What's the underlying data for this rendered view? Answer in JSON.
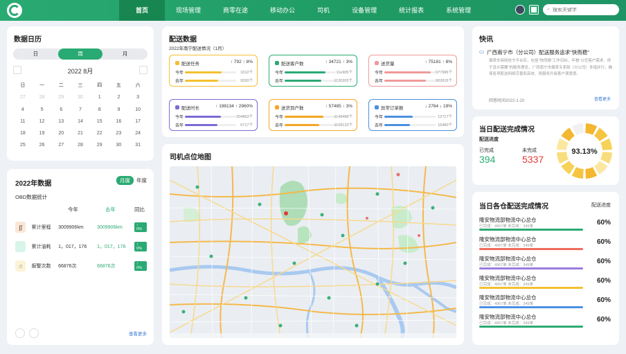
{
  "nav": {
    "items": [
      "首页",
      "现场管理",
      "商零在途",
      "移动办公",
      "司机",
      "设备管理",
      "统计报表",
      "系统管理"
    ],
    "search_placeholder": "搜索关键字"
  },
  "calendar": {
    "title": "数据日历",
    "tabs": [
      "日",
      "周",
      "月"
    ],
    "month": "2022 8月",
    "weekdays": [
      "日",
      "一",
      "二",
      "三",
      "四",
      "五",
      "六"
    ],
    "days": [
      {
        "d": "27",
        "dim": true
      },
      {
        "d": "28",
        "dim": true
      },
      {
        "d": "29",
        "dim": true
      },
      {
        "d": "30",
        "dim": true
      },
      {
        "d": "1",
        "dim": false
      },
      {
        "d": "2",
        "dim": false
      },
      {
        "d": "3",
        "dim": false
      },
      {
        "d": "4",
        "dim": false
      },
      {
        "d": "5",
        "dim": false
      },
      {
        "d": "6",
        "dim": false
      },
      {
        "d": "7",
        "dim": false
      },
      {
        "d": "8",
        "dim": false
      },
      {
        "d": "9",
        "dim": false
      },
      {
        "d": "10",
        "dim": false
      },
      {
        "d": "11",
        "dim": false
      },
      {
        "d": "12",
        "dim": false
      },
      {
        "d": "13",
        "dim": false
      },
      {
        "d": "14",
        "dim": false
      },
      {
        "d": "15",
        "dim": false
      },
      {
        "d": "16",
        "dim": false
      },
      {
        "d": "17",
        "dim": false
      },
      {
        "d": "18",
        "dim": false
      },
      {
        "d": "19",
        "dim": false
      },
      {
        "d": "20",
        "dim": false
      },
      {
        "d": "21",
        "dim": false
      },
      {
        "d": "22",
        "dim": false
      },
      {
        "d": "23",
        "dim": false
      },
      {
        "d": "24",
        "dim": false
      },
      {
        "d": "25",
        "dim": false
      },
      {
        "d": "26",
        "dim": false
      },
      {
        "d": "27",
        "dim": false
      },
      {
        "d": "28",
        "dim": false
      },
      {
        "d": "29",
        "dim": false
      },
      {
        "d": "30",
        "dim": false
      },
      {
        "d": "31",
        "dim": false
      }
    ]
  },
  "year_data": {
    "title": "2022年数据",
    "toggle": [
      "月度",
      "年度"
    ],
    "subtitle": "OBD数据统计",
    "cols": [
      "今年",
      "去年",
      "同比"
    ],
    "rows": [
      {
        "label": "累计里程",
        "this": "3009906km",
        "last": "3009906km",
        "badge": "↑ 0%",
        "icon": "road-icon",
        "color": "#fbe6d6",
        "glyph": "∫∫"
      },
      {
        "label": "累计油耗",
        "this": "1，017，176",
        "last": "1，017，176",
        "badge": "↑ 0%",
        "icon": "fuel-icon",
        "color": "#d8f5ea",
        "glyph": ""
      },
      {
        "label": "报警次数",
        "this": "66876次",
        "last": "66876次",
        "badge": "↑ 0%",
        "icon": "alarm-icon",
        "color": "#fdf3d6",
        "glyph": "☝"
      }
    ],
    "more": "查看更多"
  },
  "delivery": {
    "title": "配送数据",
    "subtitle": "2022年南宁配送情况（1月）",
    "cards": [
      {
        "name": "配送任务",
        "value": "↑ 792 ↑ 8%",
        "this_label": "今年",
        "last_label": "去年",
        "this_num": "1012个",
        "last_num": "9320个",
        "color": "#f3c02f",
        "fill": 0.72
      },
      {
        "name": "配送客户数",
        "value": "↑ 34721 ↑ 3%",
        "this_label": "今年",
        "last_label": "去年",
        "this_num": "11e905个",
        "last_num": "1126303个",
        "color": "#2aaa73",
        "fill": 0.8
      },
      {
        "name": "送货量",
        "value": "↑ 75181 ↑ 8%",
        "this_label": "今年",
        "last_label": "去年",
        "this_num": "977995个",
        "last_num": "902615个",
        "color": "#ef9a9a",
        "fill": 0.9
      },
      {
        "name": "配送时长",
        "value": "↑ 198134 ↑ 2960%",
        "this_label": "今年",
        "last_label": "去年",
        "this_num": "204863个",
        "last_num": "6717个",
        "color": "#7b6bd6",
        "fill": 0.7
      },
      {
        "name": "送货到户数",
        "value": "↑ 57485 ↑ 3%",
        "this_label": "今年",
        "last_label": "去年",
        "this_num": "1149488个",
        "last_num": "1109123个",
        "color": "#f5a623",
        "fill": 0.75
      },
      {
        "name": "异常订单数",
        "value": "↓ 2764 ↓ 19%",
        "this_label": "今年",
        "last_label": "去年",
        "this_num": "12717个",
        "last_num": "15480个",
        "color": "#4a90e2",
        "fill": 0.55
      }
    ]
  },
  "map": {
    "title": "司机点位地图"
  },
  "news": {
    "title": "快讯",
    "headline": "广西南宁市（分公司）配送服务追求\"快而稳\"",
    "body": "烟草市商网信令平台实，包括\"快而稳\"工作目标，牢看\"以任客户需求、终于设计需要\"的服务理念，广西南宁市烟草专卖局（分公司）多措并行，确保各项配送网络完善和高效、扬服务升级客户满意度。",
    "time": "回答时间2022-1-20",
    "more": "查看更多"
  },
  "today": {
    "title": "当日配送完成情况",
    "sub": "配送进度",
    "done_label": "已完成",
    "todo_label": "未完成",
    "done": "394",
    "todo": "5337",
    "percent": "93.13%",
    "progress": 0.9313
  },
  "warehouse": {
    "title": "当日各仓配送完成情况",
    "tag": "配送进度",
    "rows": [
      {
        "name": "隆安物流部物流中心总仓",
        "meta": "已完成：4967单     未完成：349单",
        "pct": "60%",
        "color": "#2aaa73"
      },
      {
        "name": "隆安物流部物流中心总仓",
        "meta": "已完成：4967单     未完成：349单",
        "pct": "60%",
        "color": "#ef6b5a"
      },
      {
        "name": "隆安物流部物流中心总仓",
        "meta": "已完成：4967单     未完成：349单",
        "pct": "60%",
        "color": "#9b7be0"
      },
      {
        "name": "隆安物流部物流中心总仓",
        "meta": "已完成：4967单     未完成：349单",
        "pct": "60%",
        "color": "#f3c02f"
      },
      {
        "name": "隆安物流部物流中心总仓",
        "meta": "已完成：4967单     未完成：349单",
        "pct": "60%",
        "color": "#4a90e2"
      },
      {
        "name": "隆安物流部物流中心总仓",
        "meta": "已完成：4967单     未完成：349单",
        "pct": "60%",
        "color": "#2aaa73"
      }
    ]
  }
}
